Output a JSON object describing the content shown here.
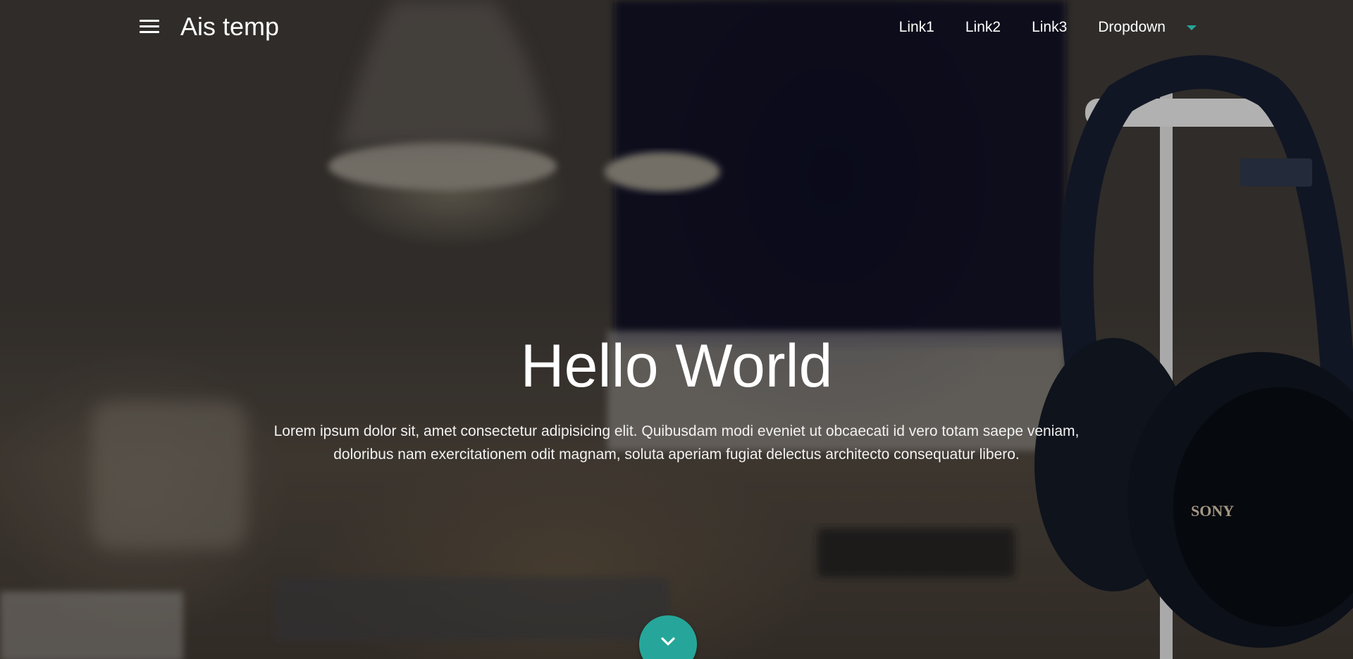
{
  "navbar": {
    "brand": "Ais temp",
    "links": [
      "Link1",
      "Link2",
      "Link3"
    ],
    "dropdown_label": "Dropdown"
  },
  "hero": {
    "title": "Hello World",
    "text": "Lorem ipsum dolor sit, amet consectetur adipisicing elit. Quibusdam modi eveniet ut obcaecati id vero totam saepe veniam, doloribus nam exercitationem odit magnam, soluta aperiam fugiat delectus architecto consequatur libero."
  },
  "colors": {
    "accent": "#26a69a",
    "text": "#ffffff"
  },
  "icons": {
    "menu": "hamburger-menu-icon",
    "dropdown": "caret-down-icon",
    "scroll": "chevron-down-icon"
  }
}
